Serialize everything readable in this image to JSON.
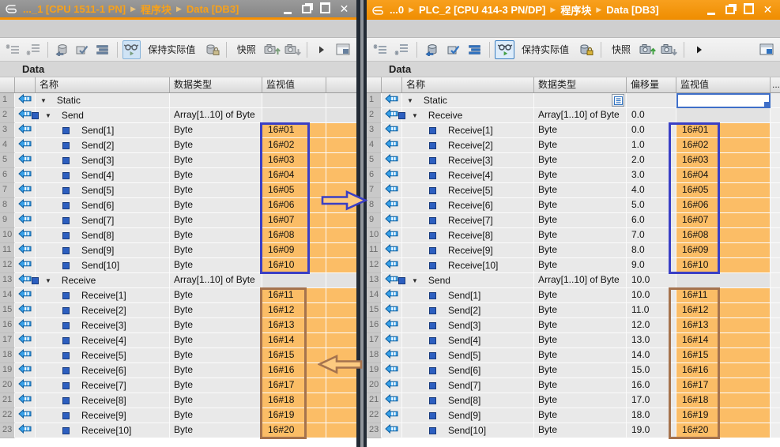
{
  "colors": {
    "title_orange": "#F39100",
    "inactive_title_text": "#F7A11A",
    "monitor_cell_orange": "#FBBD66",
    "annotation_blue": "#3A3FC5",
    "annotation_brown": "#A5734E",
    "selection_blue": "#3F6FC8",
    "tag_icon_blue": "#37A0E8"
  },
  "left_window": {
    "breadcrumb": [
      "..._1 [CPU 1511-1 PN]",
      "程序块",
      "Data [DB3]"
    ],
    "panel_title": "Data",
    "toolbar": {
      "keep_actual_values": "保持实际值",
      "snapshot": "快照"
    },
    "columns": {
      "name": "名称",
      "type": "数据类型",
      "value": "监视值"
    },
    "rows": [
      {
        "n": "1",
        "kind": "root",
        "name": "Static",
        "type": "",
        "value": "",
        "orange": false
      },
      {
        "n": "2",
        "kind": "array",
        "name": "Send",
        "type": "Array[1..10] of Byte",
        "value": "",
        "orange": false
      },
      {
        "n": "3",
        "kind": "item",
        "name": "Send[1]",
        "type": "Byte",
        "value": "16#01",
        "orange": true
      },
      {
        "n": "4",
        "kind": "item",
        "name": "Send[2]",
        "type": "Byte",
        "value": "16#02",
        "orange": true
      },
      {
        "n": "5",
        "kind": "item",
        "name": "Send[3]",
        "type": "Byte",
        "value": "16#03",
        "orange": true
      },
      {
        "n": "6",
        "kind": "item",
        "name": "Send[4]",
        "type": "Byte",
        "value": "16#04",
        "orange": true
      },
      {
        "n": "7",
        "kind": "item",
        "name": "Send[5]",
        "type": "Byte",
        "value": "16#05",
        "orange": true
      },
      {
        "n": "8",
        "kind": "item",
        "name": "Send[6]",
        "type": "Byte",
        "value": "16#06",
        "orange": true
      },
      {
        "n": "9",
        "kind": "item",
        "name": "Send[7]",
        "type": "Byte",
        "value": "16#07",
        "orange": true
      },
      {
        "n": "10",
        "kind": "item",
        "name": "Send[8]",
        "type": "Byte",
        "value": "16#08",
        "orange": true
      },
      {
        "n": "11",
        "kind": "item",
        "name": "Send[9]",
        "type": "Byte",
        "value": "16#09",
        "orange": true
      },
      {
        "n": "12",
        "kind": "item",
        "name": "Send[10]",
        "type": "Byte",
        "value": "16#10",
        "orange": true
      },
      {
        "n": "13",
        "kind": "array",
        "name": "Receive",
        "type": "Array[1..10] of Byte",
        "value": "",
        "orange": false
      },
      {
        "n": "14",
        "kind": "item",
        "name": "Receive[1]",
        "type": "Byte",
        "value": "16#11",
        "orange": true
      },
      {
        "n": "15",
        "kind": "item",
        "name": "Receive[2]",
        "type": "Byte",
        "value": "16#12",
        "orange": true
      },
      {
        "n": "16",
        "kind": "item",
        "name": "Receive[3]",
        "type": "Byte",
        "value": "16#13",
        "orange": true
      },
      {
        "n": "17",
        "kind": "item",
        "name": "Receive[4]",
        "type": "Byte",
        "value": "16#14",
        "orange": true
      },
      {
        "n": "18",
        "kind": "item",
        "name": "Receive[5]",
        "type": "Byte",
        "value": "16#15",
        "orange": true
      },
      {
        "n": "19",
        "kind": "item",
        "name": "Receive[6]",
        "type": "Byte",
        "value": "16#16",
        "orange": true
      },
      {
        "n": "20",
        "kind": "item",
        "name": "Receive[7]",
        "type": "Byte",
        "value": "16#17",
        "orange": true
      },
      {
        "n": "21",
        "kind": "item",
        "name": "Receive[8]",
        "type": "Byte",
        "value": "16#18",
        "orange": true
      },
      {
        "n": "22",
        "kind": "item",
        "name": "Receive[9]",
        "type": "Byte",
        "value": "16#19",
        "orange": true
      },
      {
        "n": "23",
        "kind": "item",
        "name": "Receive[10]",
        "type": "Byte",
        "value": "16#20",
        "orange": true
      }
    ]
  },
  "right_window": {
    "breadcrumb": [
      "...0",
      "PLC_2 [CPU 414-3 PN/DP]",
      "程序块",
      "Data [DB3]"
    ],
    "panel_title": "Data",
    "toolbar": {
      "keep_actual_values": "保持实际值",
      "snapshot": "快照"
    },
    "columns": {
      "name": "名称",
      "type": "数据类型",
      "offset": "偏移量",
      "value": "监视值",
      "more": "..."
    },
    "rows": [
      {
        "n": "1",
        "kind": "root",
        "name": "Static",
        "type": "",
        "offset": "",
        "value": "",
        "orange": false,
        "selected": true,
        "typebtn": true
      },
      {
        "n": "2",
        "kind": "array",
        "name": "Receive",
        "type": "Array[1..10] of Byte",
        "offset": "0.0",
        "value": "",
        "orange": false
      },
      {
        "n": "3",
        "kind": "item",
        "name": "Receive[1]",
        "type": "Byte",
        "offset": "0.0",
        "value": "16#01",
        "orange": true
      },
      {
        "n": "4",
        "kind": "item",
        "name": "Receive[2]",
        "type": "Byte",
        "offset": "1.0",
        "value": "16#02",
        "orange": true
      },
      {
        "n": "5",
        "kind": "item",
        "name": "Receive[3]",
        "type": "Byte",
        "offset": "2.0",
        "value": "16#03",
        "orange": true
      },
      {
        "n": "6",
        "kind": "item",
        "name": "Receive[4]",
        "type": "Byte",
        "offset": "3.0",
        "value": "16#04",
        "orange": true
      },
      {
        "n": "7",
        "kind": "item",
        "name": "Receive[5]",
        "type": "Byte",
        "offset": "4.0",
        "value": "16#05",
        "orange": true
      },
      {
        "n": "8",
        "kind": "item",
        "name": "Receive[6]",
        "type": "Byte",
        "offset": "5.0",
        "value": "16#06",
        "orange": true
      },
      {
        "n": "9",
        "kind": "item",
        "name": "Receive[7]",
        "type": "Byte",
        "offset": "6.0",
        "value": "16#07",
        "orange": true
      },
      {
        "n": "10",
        "kind": "item",
        "name": "Receive[8]",
        "type": "Byte",
        "offset": "7.0",
        "value": "16#08",
        "orange": true
      },
      {
        "n": "11",
        "kind": "item",
        "name": "Receive[9]",
        "type": "Byte",
        "offset": "8.0",
        "value": "16#09",
        "orange": true
      },
      {
        "n": "12",
        "kind": "item",
        "name": "Receive[10]",
        "type": "Byte",
        "offset": "9.0",
        "value": "16#10",
        "orange": true
      },
      {
        "n": "13",
        "kind": "array",
        "name": "Send",
        "type": "Array[1..10] of Byte",
        "offset": "10.0",
        "value": "",
        "orange": false
      },
      {
        "n": "14",
        "kind": "item",
        "name": "Send[1]",
        "type": "Byte",
        "offset": "10.0",
        "value": "16#11",
        "orange": true
      },
      {
        "n": "15",
        "kind": "item",
        "name": "Send[2]",
        "type": "Byte",
        "offset": "11.0",
        "value": "16#12",
        "orange": true
      },
      {
        "n": "16",
        "kind": "item",
        "name": "Send[3]",
        "type": "Byte",
        "offset": "12.0",
        "value": "16#13",
        "orange": true
      },
      {
        "n": "17",
        "kind": "item",
        "name": "Send[4]",
        "type": "Byte",
        "offset": "13.0",
        "value": "16#14",
        "orange": true
      },
      {
        "n": "18",
        "kind": "item",
        "name": "Send[5]",
        "type": "Byte",
        "offset": "14.0",
        "value": "16#15",
        "orange": true
      },
      {
        "n": "19",
        "kind": "item",
        "name": "Send[6]",
        "type": "Byte",
        "offset": "15.0",
        "value": "16#16",
        "orange": true
      },
      {
        "n": "20",
        "kind": "item",
        "name": "Send[7]",
        "type": "Byte",
        "offset": "16.0",
        "value": "16#17",
        "orange": true
      },
      {
        "n": "21",
        "kind": "item",
        "name": "Send[8]",
        "type": "Byte",
        "offset": "17.0",
        "value": "16#18",
        "orange": true
      },
      {
        "n": "22",
        "kind": "item",
        "name": "Send[9]",
        "type": "Byte",
        "offset": "18.0",
        "value": "16#19",
        "orange": true
      },
      {
        "n": "23",
        "kind": "item",
        "name": "Send[10]",
        "type": "Byte",
        "offset": "19.0",
        "value": "16#20",
        "orange": true
      }
    ]
  },
  "annotations": {
    "blue_color": "#3A3FC5",
    "brown_color": "#A5734E",
    "blue_boxes": [
      "left-send-monitor-values",
      "right-receive-monitor-values"
    ],
    "brown_boxes": [
      "left-receive-monitor-values",
      "right-send-monitor-values"
    ],
    "arrows": [
      {
        "name": "send-to-receive-arrow",
        "direction": "right",
        "color": "blue"
      },
      {
        "name": "receive-from-send-arrow",
        "direction": "left",
        "color": "brown"
      }
    ]
  }
}
